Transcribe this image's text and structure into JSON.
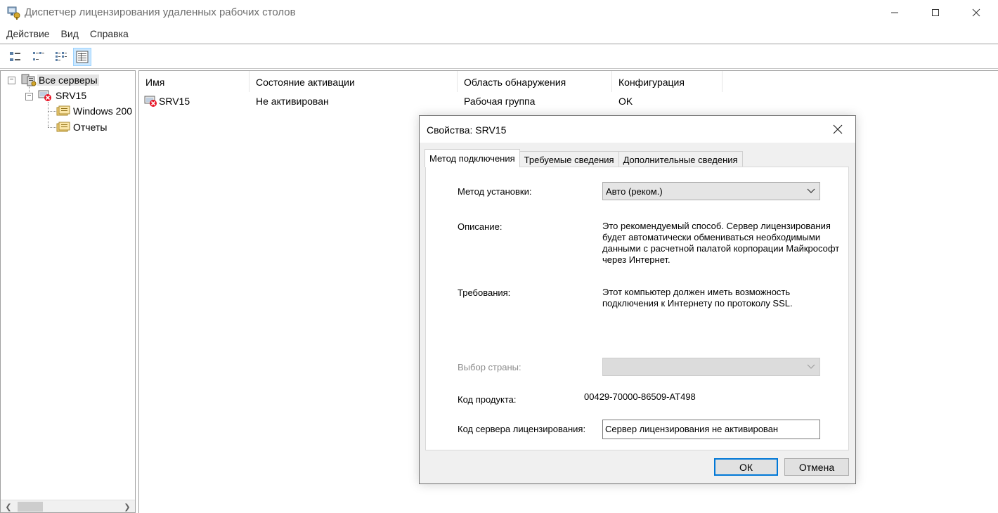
{
  "window": {
    "title": "Диспетчер лицензирования удаленных рабочих столов"
  },
  "menu": [
    {
      "label": "Действие"
    },
    {
      "label": "Вид"
    },
    {
      "label": "Справка"
    }
  ],
  "toolbar": {
    "buttons": [
      {
        "icon": "large-icons-view-icon"
      },
      {
        "icon": "small-icons-view-icon"
      },
      {
        "icon": "list-view-icon"
      },
      {
        "icon": "details-view-icon",
        "active": true
      }
    ]
  },
  "tree": {
    "root": "Все серверы",
    "server": "SRV15",
    "children": [
      "Windows 200",
      "Отчеты"
    ]
  },
  "list": {
    "columns": [
      "Имя",
      "Состояние активации",
      "Область обнаружения",
      "Конфигурация"
    ],
    "rows": [
      {
        "name": "SRV15",
        "state": "Не активирован",
        "scope": "Рабочая группа",
        "config": "OK"
      }
    ]
  },
  "dialog": {
    "title": "Свойства: SRV15",
    "tabs": [
      "Метод подключения",
      "Требуемые сведения",
      "Дополнительные сведения"
    ],
    "install_method_label": "Метод установки:",
    "install_method_value": "Авто (реком.)",
    "description_label": "Описание:",
    "description_text": "Это рекомендуемый способ. Сервер лицензирования будет автоматически обмениваться необходимыми данными с расчетной палатой корпорации Майкрософт через Интернет.",
    "requirements_label": "Требования:",
    "requirements_text": "Этот компьютер должен иметь возможность подключения к Интернету по протоколу SSL.",
    "country_label": "Выбор страны:",
    "country_value": "",
    "product_code_label": "Код продукта:",
    "product_code_value": "00429-70000-86509-AT498",
    "license_server_code_label": "Код сервера лицензирования:",
    "license_server_code_value": "Сервер лицензирования не активирован",
    "ok_label": "ОК",
    "cancel_label": "Отмена"
  },
  "colors": {
    "accent": "#0078d7",
    "error": "#e81123"
  }
}
